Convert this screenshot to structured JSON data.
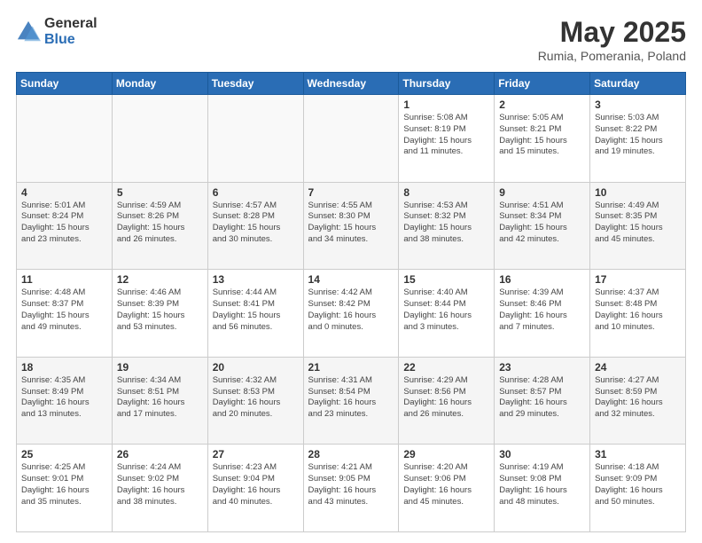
{
  "header": {
    "logo_general": "General",
    "logo_blue": "Blue",
    "title": "May 2025",
    "subtitle": "Rumia, Pomerania, Poland"
  },
  "days_of_week": [
    "Sunday",
    "Monday",
    "Tuesday",
    "Wednesday",
    "Thursday",
    "Friday",
    "Saturday"
  ],
  "weeks": [
    [
      {
        "day": "",
        "info": ""
      },
      {
        "day": "",
        "info": ""
      },
      {
        "day": "",
        "info": ""
      },
      {
        "day": "",
        "info": ""
      },
      {
        "day": "1",
        "info": "Sunrise: 5:08 AM\nSunset: 8:19 PM\nDaylight: 15 hours\nand 11 minutes."
      },
      {
        "day": "2",
        "info": "Sunrise: 5:05 AM\nSunset: 8:21 PM\nDaylight: 15 hours\nand 15 minutes."
      },
      {
        "day": "3",
        "info": "Sunrise: 5:03 AM\nSunset: 8:22 PM\nDaylight: 15 hours\nand 19 minutes."
      }
    ],
    [
      {
        "day": "4",
        "info": "Sunrise: 5:01 AM\nSunset: 8:24 PM\nDaylight: 15 hours\nand 23 minutes."
      },
      {
        "day": "5",
        "info": "Sunrise: 4:59 AM\nSunset: 8:26 PM\nDaylight: 15 hours\nand 26 minutes."
      },
      {
        "day": "6",
        "info": "Sunrise: 4:57 AM\nSunset: 8:28 PM\nDaylight: 15 hours\nand 30 minutes."
      },
      {
        "day": "7",
        "info": "Sunrise: 4:55 AM\nSunset: 8:30 PM\nDaylight: 15 hours\nand 34 minutes."
      },
      {
        "day": "8",
        "info": "Sunrise: 4:53 AM\nSunset: 8:32 PM\nDaylight: 15 hours\nand 38 minutes."
      },
      {
        "day": "9",
        "info": "Sunrise: 4:51 AM\nSunset: 8:34 PM\nDaylight: 15 hours\nand 42 minutes."
      },
      {
        "day": "10",
        "info": "Sunrise: 4:49 AM\nSunset: 8:35 PM\nDaylight: 15 hours\nand 45 minutes."
      }
    ],
    [
      {
        "day": "11",
        "info": "Sunrise: 4:48 AM\nSunset: 8:37 PM\nDaylight: 15 hours\nand 49 minutes."
      },
      {
        "day": "12",
        "info": "Sunrise: 4:46 AM\nSunset: 8:39 PM\nDaylight: 15 hours\nand 53 minutes."
      },
      {
        "day": "13",
        "info": "Sunrise: 4:44 AM\nSunset: 8:41 PM\nDaylight: 15 hours\nand 56 minutes."
      },
      {
        "day": "14",
        "info": "Sunrise: 4:42 AM\nSunset: 8:42 PM\nDaylight: 16 hours\nand 0 minutes."
      },
      {
        "day": "15",
        "info": "Sunrise: 4:40 AM\nSunset: 8:44 PM\nDaylight: 16 hours\nand 3 minutes."
      },
      {
        "day": "16",
        "info": "Sunrise: 4:39 AM\nSunset: 8:46 PM\nDaylight: 16 hours\nand 7 minutes."
      },
      {
        "day": "17",
        "info": "Sunrise: 4:37 AM\nSunset: 8:48 PM\nDaylight: 16 hours\nand 10 minutes."
      }
    ],
    [
      {
        "day": "18",
        "info": "Sunrise: 4:35 AM\nSunset: 8:49 PM\nDaylight: 16 hours\nand 13 minutes."
      },
      {
        "day": "19",
        "info": "Sunrise: 4:34 AM\nSunset: 8:51 PM\nDaylight: 16 hours\nand 17 minutes."
      },
      {
        "day": "20",
        "info": "Sunrise: 4:32 AM\nSunset: 8:53 PM\nDaylight: 16 hours\nand 20 minutes."
      },
      {
        "day": "21",
        "info": "Sunrise: 4:31 AM\nSunset: 8:54 PM\nDaylight: 16 hours\nand 23 minutes."
      },
      {
        "day": "22",
        "info": "Sunrise: 4:29 AM\nSunset: 8:56 PM\nDaylight: 16 hours\nand 26 minutes."
      },
      {
        "day": "23",
        "info": "Sunrise: 4:28 AM\nSunset: 8:57 PM\nDaylight: 16 hours\nand 29 minutes."
      },
      {
        "day": "24",
        "info": "Sunrise: 4:27 AM\nSunset: 8:59 PM\nDaylight: 16 hours\nand 32 minutes."
      }
    ],
    [
      {
        "day": "25",
        "info": "Sunrise: 4:25 AM\nSunset: 9:01 PM\nDaylight: 16 hours\nand 35 minutes."
      },
      {
        "day": "26",
        "info": "Sunrise: 4:24 AM\nSunset: 9:02 PM\nDaylight: 16 hours\nand 38 minutes."
      },
      {
        "day": "27",
        "info": "Sunrise: 4:23 AM\nSunset: 9:04 PM\nDaylight: 16 hours\nand 40 minutes."
      },
      {
        "day": "28",
        "info": "Sunrise: 4:21 AM\nSunset: 9:05 PM\nDaylight: 16 hours\nand 43 minutes."
      },
      {
        "day": "29",
        "info": "Sunrise: 4:20 AM\nSunset: 9:06 PM\nDaylight: 16 hours\nand 45 minutes."
      },
      {
        "day": "30",
        "info": "Sunrise: 4:19 AM\nSunset: 9:08 PM\nDaylight: 16 hours\nand 48 minutes."
      },
      {
        "day": "31",
        "info": "Sunrise: 4:18 AM\nSunset: 9:09 PM\nDaylight: 16 hours\nand 50 minutes."
      }
    ]
  ]
}
